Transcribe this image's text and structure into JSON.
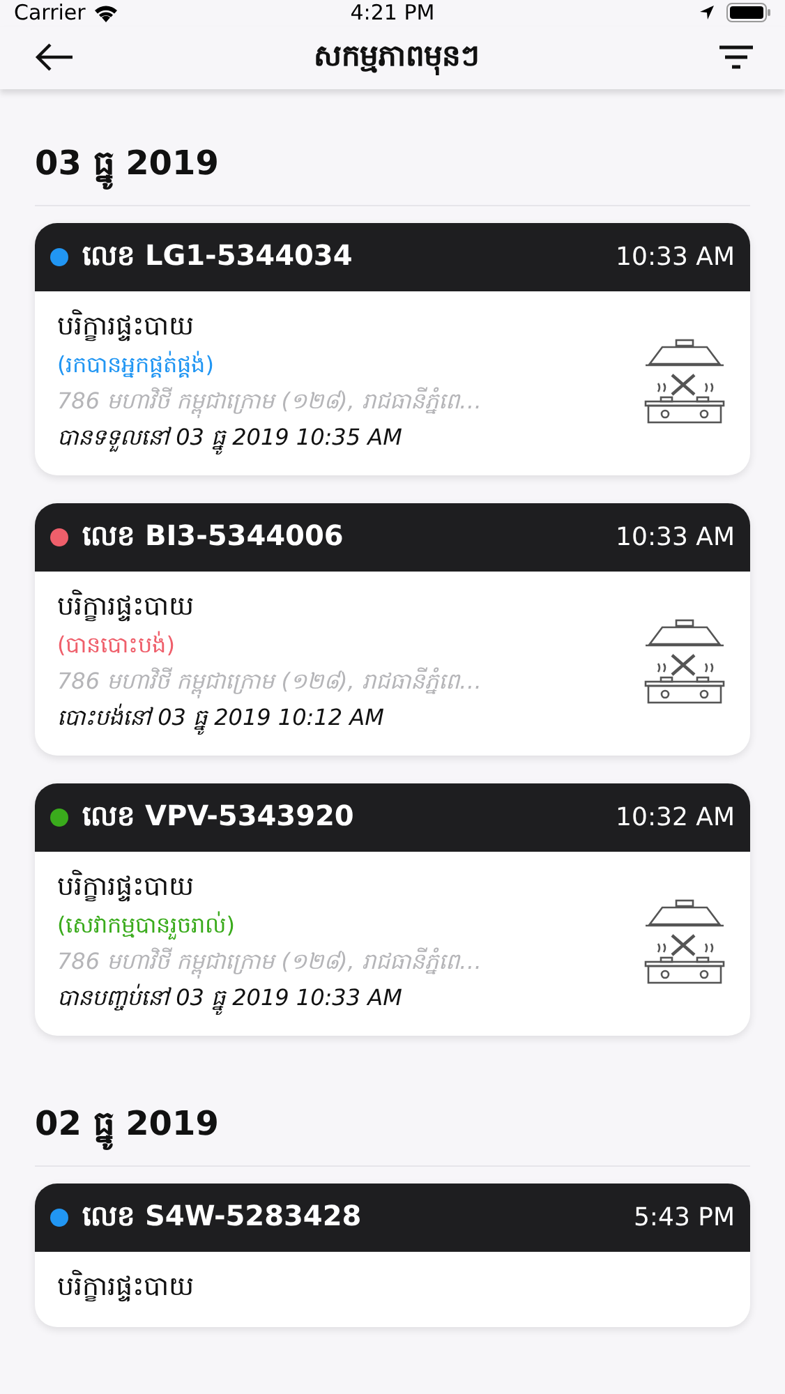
{
  "status_bar": {
    "carrier": "Carrier",
    "time": "4:21 PM"
  },
  "nav": {
    "title": "សកម្មភាពមុនៗ"
  },
  "sections": [
    {
      "date": "03 ធ្នូ 2019",
      "orders": [
        {
          "number": "លេខ LG1-5344034",
          "time": "10:33 AM",
          "color": "#2196f3",
          "service": "បរិក្ខារផ្ទះបាយ",
          "status": "(រកបានអ្នកផ្គត់ផ្គង់)",
          "address": "786 មហាវិថី កម្ពុជាក្រោម (១២៨), រាជធានីភ្នំពេ…",
          "event": "បានទទួលនៅ 03 ធ្នូ 2019 10:35 AM"
        },
        {
          "number": "លេខ BI3-5344006",
          "time": "10:33 AM",
          "color": "#ef5f6b",
          "service": "បរិក្ខារផ្ទះបាយ",
          "status": "(បានបោះបង់)",
          "address": "786 មហាវិថី កម្ពុជាក្រោម (១២៨), រាជធានីភ្នំពេ…",
          "event": "បោះបង់នៅ 03 ធ្នូ 2019 10:12 AM"
        },
        {
          "number": "លេខ VPV-5343920",
          "time": "10:32 AM",
          "color": "#3aab1c",
          "service": "បរិក្ខារផ្ទះបាយ",
          "status": "(សេវាកម្មបានរួចរាល់)",
          "address": "786 មហាវិថី កម្ពុជាក្រោម (១២៨), រាជធានីភ្នំពេ…",
          "event": "បានបញ្ចប់នៅ 03 ធ្នូ 2019 10:33 AM"
        }
      ]
    },
    {
      "date": "02 ធ្នូ 2019",
      "orders": [
        {
          "number": "លេខ S4W-5283428",
          "time": "5:43 PM",
          "color": "#2196f3",
          "service": "បរិក្ខារផ្ទះបាយ"
        }
      ]
    }
  ]
}
